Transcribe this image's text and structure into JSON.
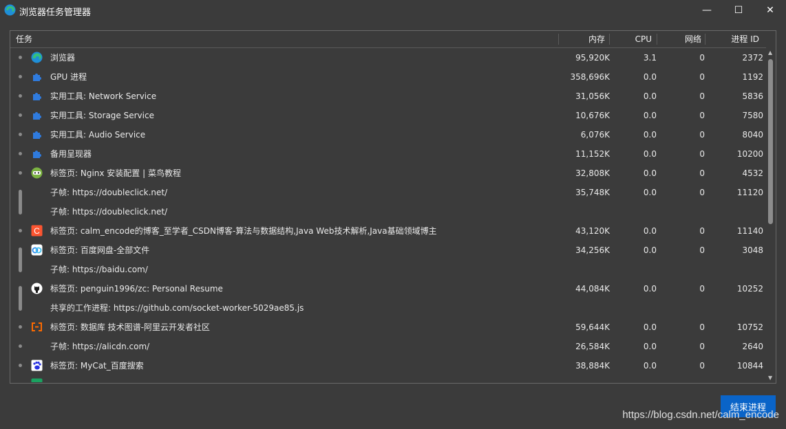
{
  "window": {
    "title": "浏览器任务管理器",
    "minimize_glyph": "—",
    "maximize_glyph": "☐",
    "close_glyph": "✕"
  },
  "columns": {
    "task": "任务",
    "memory": "内存",
    "cpu": "CPU",
    "network": "网络",
    "pid": "进程 ID"
  },
  "rows": [
    {
      "icon": "edge-browser-icon",
      "name": "浏览器",
      "memory": "95,920K",
      "cpu": "3.1",
      "network": "0",
      "pid": "2372"
    },
    {
      "icon": "puzzle-icon",
      "name": "GPU 进程",
      "memory": "358,696K",
      "cpu": "0.0",
      "network": "0",
      "pid": "1192"
    },
    {
      "icon": "puzzle-icon",
      "name": "实用工具: Network Service",
      "memory": "31,056K",
      "cpu": "0.0",
      "network": "0",
      "pid": "5836"
    },
    {
      "icon": "puzzle-icon",
      "name": "实用工具: Storage Service",
      "memory": "10,676K",
      "cpu": "0.0",
      "network": "0",
      "pid": "7580"
    },
    {
      "icon": "puzzle-icon",
      "name": "实用工具: Audio Service",
      "memory": "6,076K",
      "cpu": "0.0",
      "network": "0",
      "pid": "8040"
    },
    {
      "icon": "puzzle-icon",
      "name": "备用呈现器",
      "memory": "11,152K",
      "cpu": "0.0",
      "network": "0",
      "pid": "10200"
    },
    {
      "icon": "runoob-icon",
      "name": "标签页: Nginx 安装配置 | 菜鸟教程",
      "memory": "32,808K",
      "cpu": "0.0",
      "network": "0",
      "pid": "4532"
    },
    {
      "icon": "",
      "name": "子帧: https://doubleclick.net/",
      "memory": "35,748K",
      "cpu": "0.0",
      "network": "0",
      "pid": "11120"
    },
    {
      "icon": "",
      "name": "子帧: https://doubleclick.net/",
      "memory": "",
      "cpu": "",
      "network": "",
      "pid": ""
    },
    {
      "icon": "csdn-icon",
      "name": "标签页: calm_encode的博客_至学者_CSDN博客-算法与数据结构,Java Web技术解析,Java基础领域博主",
      "memory": "43,120K",
      "cpu": "0.0",
      "network": "0",
      "pid": "11140"
    },
    {
      "icon": "baidu-netdisk-icon",
      "name": "标签页: 百度网盘-全部文件",
      "memory": "34,256K",
      "cpu": "0.0",
      "network": "0",
      "pid": "3048"
    },
    {
      "icon": "",
      "name": "子帧: https://baidu.com/",
      "memory": "",
      "cpu": "",
      "network": "",
      "pid": ""
    },
    {
      "icon": "github-icon",
      "name": "标签页: penguin1996/zc: Personal Resume",
      "memory": "44,084K",
      "cpu": "0.0",
      "network": "0",
      "pid": "10252"
    },
    {
      "icon": "",
      "name": "共享的工作进程: https://github.com/socket-worker-5029ae85.js",
      "memory": "",
      "cpu": "",
      "network": "",
      "pid": ""
    },
    {
      "icon": "aliyun-icon",
      "name": "标签页: 数据库 技术图谱-阿里云开发者社区",
      "memory": "59,644K",
      "cpu": "0.0",
      "network": "0",
      "pid": "10752"
    },
    {
      "icon": "",
      "name": "子帧: https://alicdn.com/",
      "memory": "26,584K",
      "cpu": "0.0",
      "network": "0",
      "pid": "2640"
    },
    {
      "icon": "baidu-icon",
      "name": "标签页: MyCat_百度搜索",
      "memory": "38,884K",
      "cpu": "0.0",
      "network": "0",
      "pid": "10844"
    }
  ],
  "end_process_button": "结束进程",
  "watermark": "https://blog.csdn.net/calm_encode"
}
